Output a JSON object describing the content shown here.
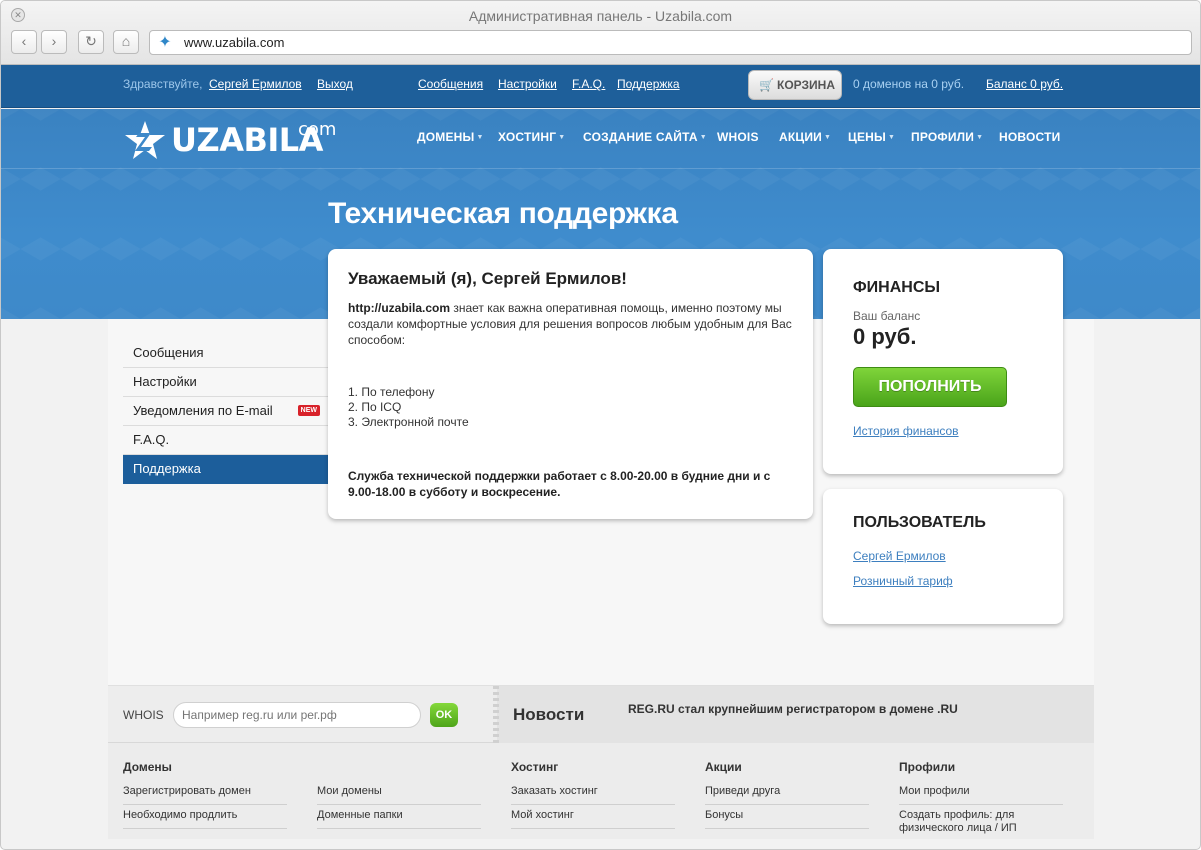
{
  "browser": {
    "window_title": "Административная панель - Uzabila.com",
    "url": "www.uzabila.com",
    "back_icon": "‹",
    "forward_icon": "›",
    "reload_icon": "↻",
    "home_icon": "⌂"
  },
  "topbar": {
    "greeting": "Здравствуйте,",
    "user_name": "Сергей Ермилов",
    "logout": "Выход",
    "links": {
      "messages": "Сообщения",
      "settings": "Настройки",
      "faq": "F.A.Q.",
      "support": "Поддержка"
    },
    "cart_label": "КОРЗИНА",
    "cart_domains": "0 доменов на 0 руб.",
    "balance": "Баланс 0 руб."
  },
  "logo": {
    "name": "UZABILA",
    "suffix": "com"
  },
  "main_nav": {
    "domains": "ДОМЕНЫ",
    "hosting": "ХОСТИНГ",
    "site_creation": "СОЗДАНИЕ САЙТА",
    "whois": "WHOIS",
    "promotions": "АКЦИИ",
    "prices": "ЦЕНЫ",
    "profiles": "ПРОФИЛИ",
    "news": "НОВОСТИ"
  },
  "page": {
    "title": "Техническая поддержка"
  },
  "left_nav": {
    "messages": "Сообщения",
    "settings": "Настройки",
    "email_notifications": "Уведомления по E-mail",
    "new_badge": "NEW",
    "faq": "F.A.Q.",
    "support": "Поддержка"
  },
  "support_card": {
    "title": "Уважаемый (я), Сергей Ермилов!",
    "site": "http://uzabila.com",
    "intro": " знает как важна оперативная помощь, именно поэтому мы создали комфортные условия для решения вопросов любым удобным для Вас способом:",
    "items": {
      "phone": "1. По телефону",
      "icq": "2. По ICQ",
      "email": "3. Электронной почте"
    },
    "hours": "Служба технической поддержки работает с 8.00-20.00 в будние дни и с 9.00-18.00 в субботу и воскресение."
  },
  "finance_card": {
    "title": "ФИНАНСЫ",
    "balance_label": "Ваш баланс",
    "balance_value": "0 руб.",
    "topup_button": "ПОПОЛНИТЬ",
    "history_link": "История финансов"
  },
  "user_card": {
    "title": "ПОЛЬЗОВАТЕЛЬ",
    "name": "Сергей Ермилов",
    "tariff": "Розничный тариф"
  },
  "whois_bar": {
    "label": "WHOIS",
    "placeholder": "Например reg.ru или рег.рф",
    "ok_button": "OK"
  },
  "news_bar": {
    "title": "Новости",
    "headline": "REG.RU стал крупнейшим регистратором в домене .RU"
  },
  "footer": {
    "domains_title": "Домены",
    "domains_register": "Зарегистрировать домен",
    "domains_renew": "Необходимо продлить",
    "my_domains": "Мои домены",
    "domain_folders": "Доменные папки",
    "hosting_title": "Хостинг",
    "order_hosting": "Заказать хостинг",
    "my_hosting": "Мой хостинг",
    "promos_title": "Акции",
    "invite_friend": "Приведи друга",
    "bonuses": "Бонусы",
    "profiles_title": "Профили",
    "my_profiles": "Мои профили",
    "create_profile": "Создать профиль: для физического лица / ИП"
  },
  "colors": {
    "topbar": "#1e5f9a",
    "hero": "#3e89c9",
    "active_nav": "#1c5e9b",
    "topup_green": "#5cb82a",
    "link": "#3d7fbf"
  }
}
